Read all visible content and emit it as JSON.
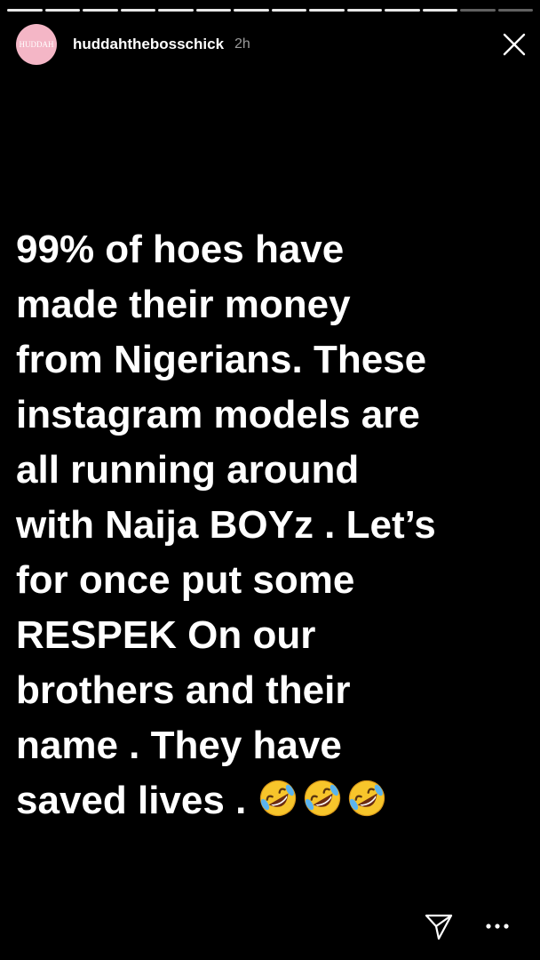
{
  "story": {
    "segment_count": 14,
    "segments_completed": 12,
    "avatar_text": "HUDDAH",
    "username": "huddahthebosschick",
    "time": "2h",
    "text_lines": [
      "99% of hoes have",
      "made their money",
      "from Nigerians. These",
      "instagram models are",
      "all running around",
      "with Naija BOYz . Let’s",
      "for once put some",
      "RESPEK On our",
      "brothers and their",
      "name . They have",
      "saved lives ."
    ],
    "emoji_count": 3,
    "emoji_name": "rolling-on-the-floor-laughing-emoji"
  },
  "icons": {
    "close": "close-icon",
    "send": "paper-plane-icon",
    "more": "more-options-icon"
  },
  "colors": {
    "background": "#000000",
    "text": "#ffffff",
    "avatar": "#f4b6c6",
    "time": "#9a9a9a"
  }
}
